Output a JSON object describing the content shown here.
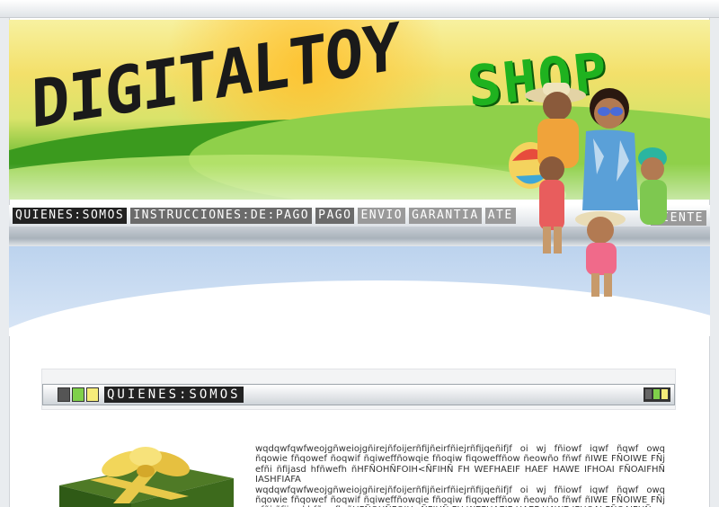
{
  "brand": {
    "logo_main": "DIGITALTOY",
    "logo_accent": "SHOP",
    "accent_color": "#1fb21f"
  },
  "nav": {
    "items": [
      {
        "label": "QUIENES:SOMOS",
        "style": "dark"
      },
      {
        "label": "INSTRUCCIONES:DE:PAGO",
        "style": "light"
      },
      {
        "label": "PAGO",
        "style": "light"
      },
      {
        "label": "ENVIO",
        "style": "dim"
      },
      {
        "label": "GARANTIA",
        "style": "dim"
      },
      {
        "label": "ATE",
        "style": "dim"
      }
    ],
    "trailing": "LIENTE"
  },
  "section": {
    "title": "QUIENES:SOMOS",
    "icons": [
      "square-dark-icon",
      "square-green-icon",
      "square-yellow-icon"
    ]
  },
  "content": {
    "paragraphs": [
      "wqdqwfqwfweojgñweiojgñirejñfoijerñfijñeirfñiejrñfijqeñifjf oi wj fñiowf iqwf ñqwf owq ñqowie fñqowef ñoqwif ñqiweffñowqie fñoqiw fiqoweffñow ñeowño fñwf ñIWE FÑOIWE FÑj efñi ñfijasd hfñwefh ñHFÑOHÑFOIH<ÑFIHÑ FH WEFHAEIF HAEF HAWE IFHOAI FÑOAIFHÑ IASHFIAFA",
      "wqdqwfqwfweojgñweiojgñirejñfoijerñfijñeirfñiejrñfijqeñifjf oi wj fñiowf iqwf ñqwf owq ñqowie fñqowef ñoqwif ñqiweffñowqie fñoqiw fiqoweffñow ñeowño fñwf ñIWE FÑOIWE FÑj efñi ñfijasd hfñwefh ñHFÑOHÑFOIH<ÑFIHÑ FH WEFHAEIF HAEF HAWE IFHOAI FÑOAIFHÑ"
    ]
  }
}
